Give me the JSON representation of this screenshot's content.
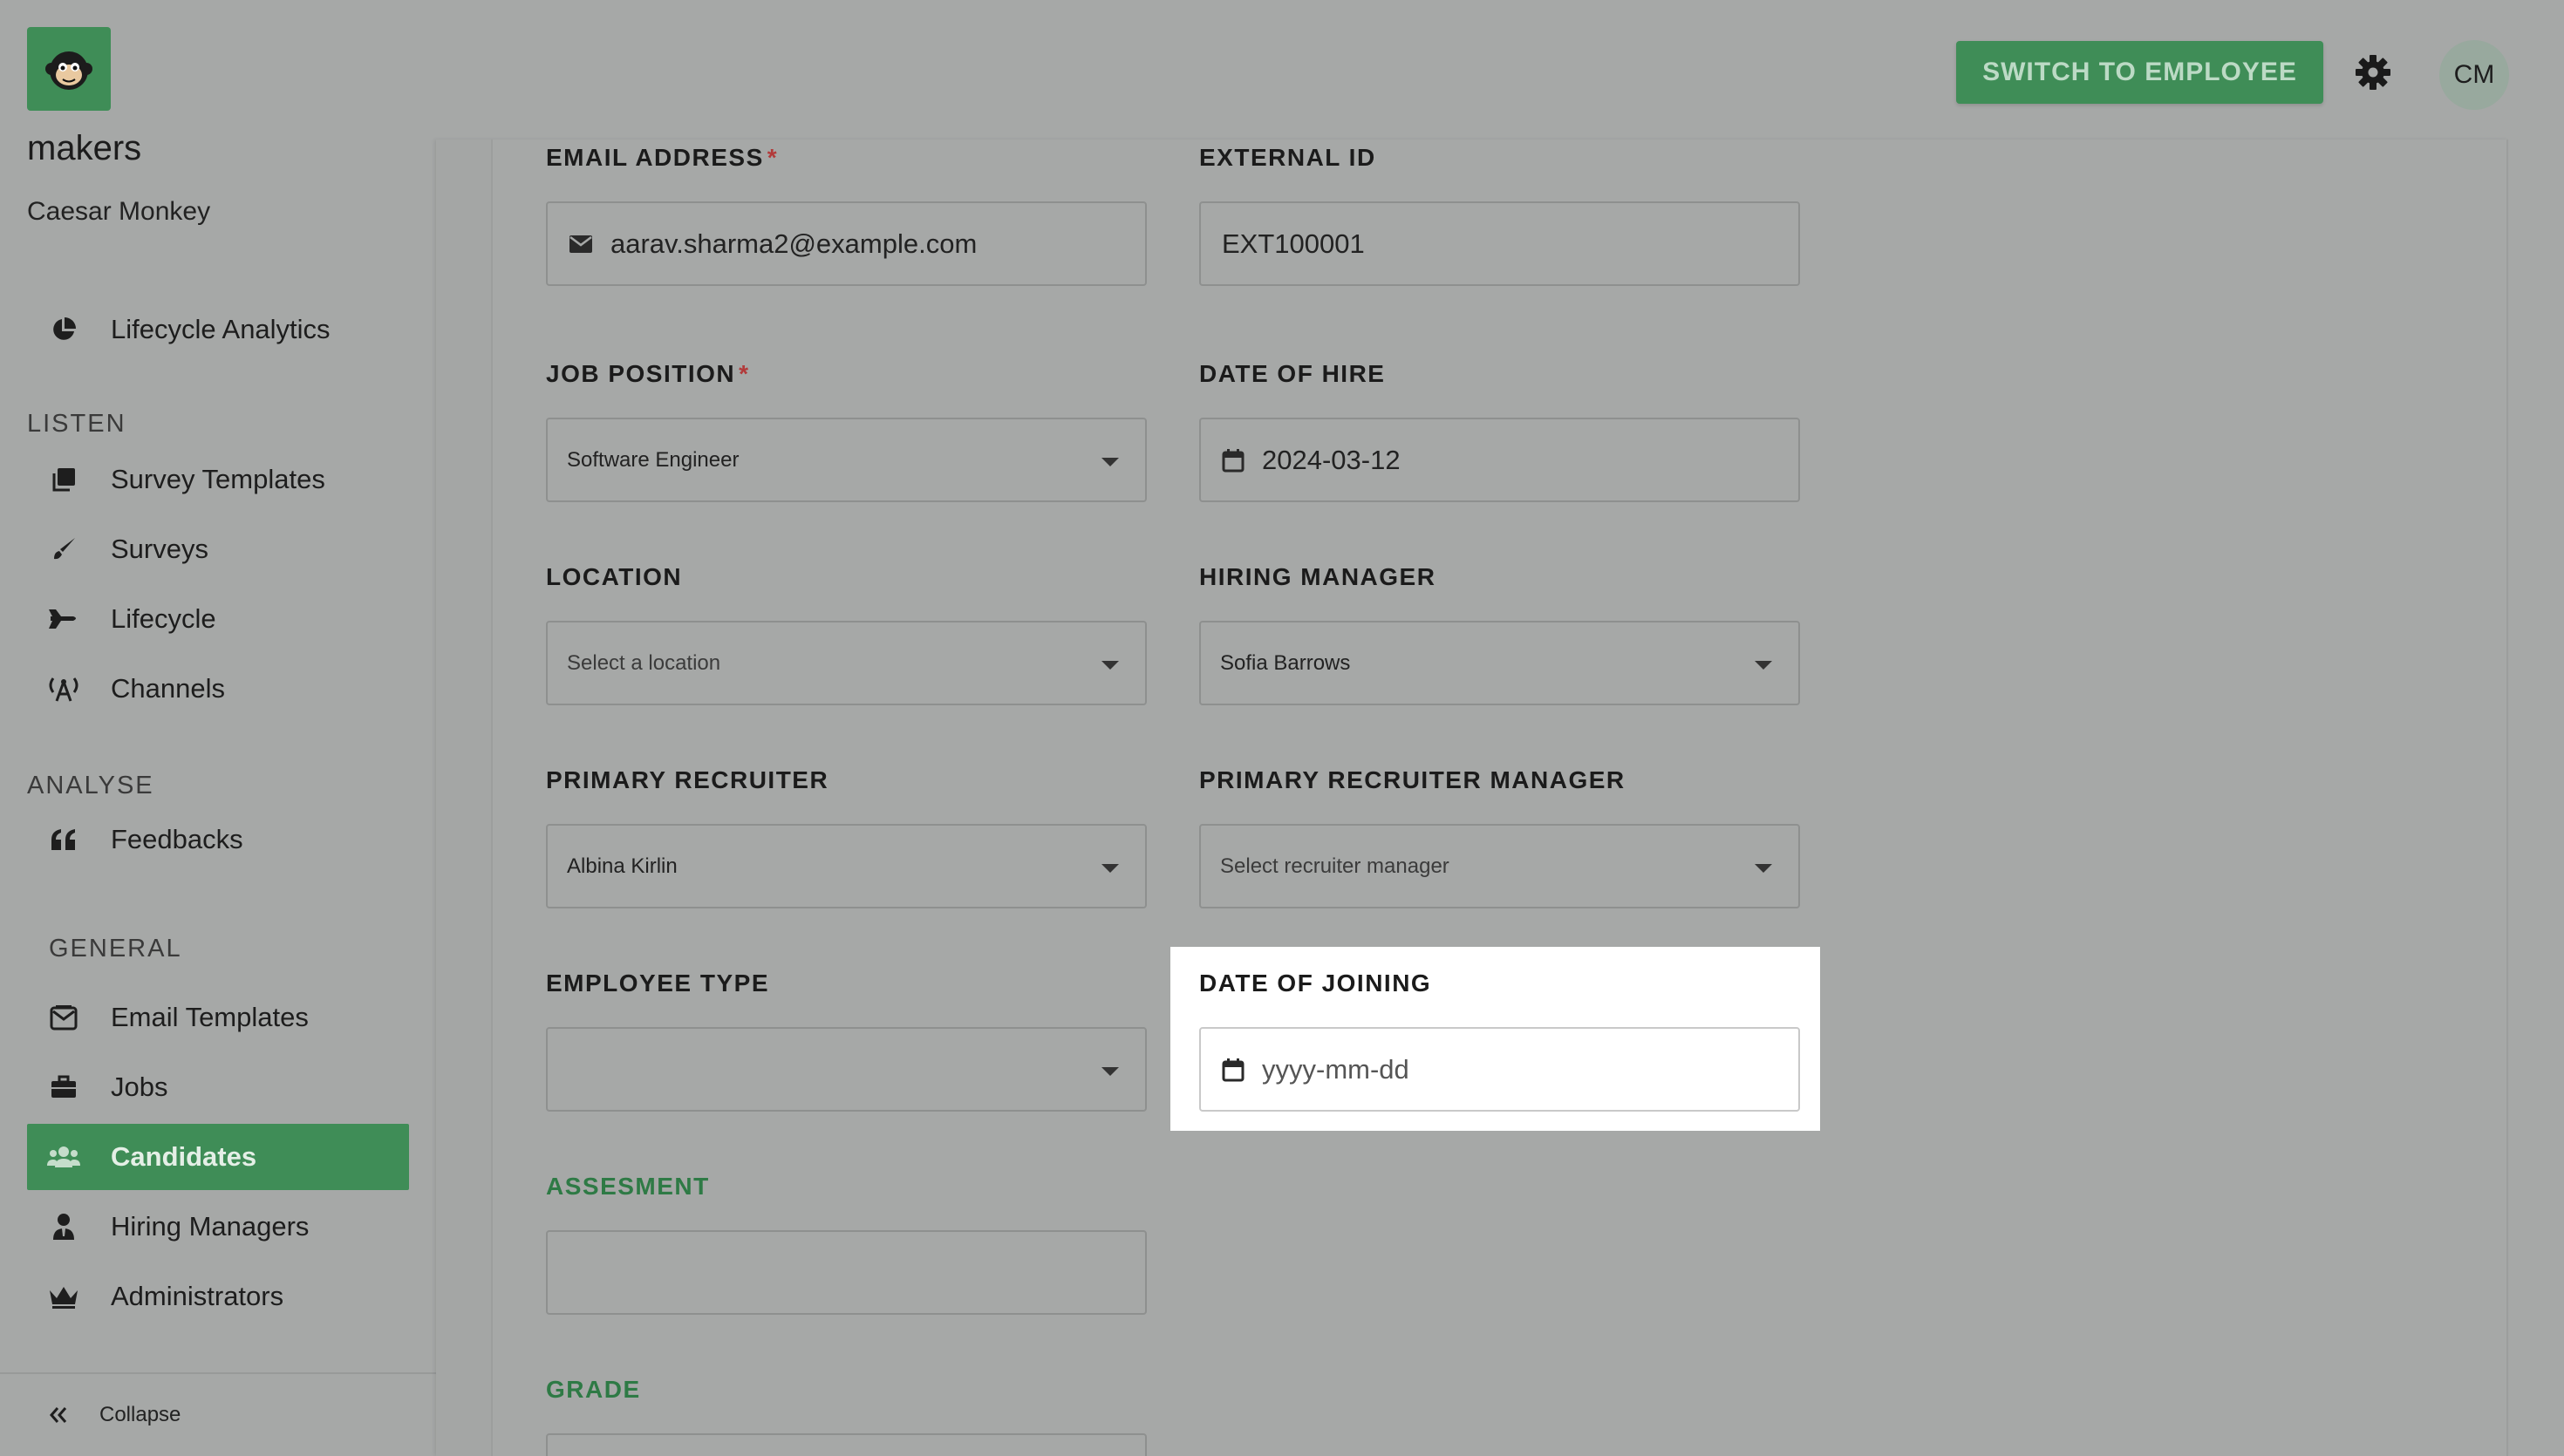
{
  "sidebar": {
    "brand": "makers",
    "user_name": "Caesar Monkey",
    "top_item": {
      "label": "Lifecycle Analytics",
      "icon": "pie-chart-icon"
    },
    "sections": [
      {
        "title": "LISTEN",
        "items": [
          {
            "label": "Survey Templates",
            "icon": "copy-icon"
          },
          {
            "label": "Surveys",
            "icon": "brush-icon"
          },
          {
            "label": "Lifecycle",
            "icon": "fighter-jet-icon"
          },
          {
            "label": "Channels",
            "icon": "broadcast-icon"
          }
        ]
      },
      {
        "title": "ANALYSE",
        "items": [
          {
            "label": "Feedbacks",
            "icon": "quote-icon"
          }
        ]
      },
      {
        "title": "GENERAL",
        "items": [
          {
            "label": "Email Templates",
            "icon": "mail-bulk-icon"
          },
          {
            "label": "Jobs",
            "icon": "briefcase-icon"
          },
          {
            "label": "Candidates",
            "icon": "users-icon",
            "active": true
          },
          {
            "label": "Hiring Managers",
            "icon": "user-tie-icon"
          },
          {
            "label": "Administrators",
            "icon": "crown-icon"
          }
        ]
      }
    ],
    "collapse_label": "Collapse"
  },
  "header": {
    "switch_label": "SWITCH TO EMPLOYEE",
    "avatar_initials": "CM"
  },
  "form": {
    "email": {
      "label": "EMAIL ADDRESS",
      "required": "*",
      "value": "aarav.sharma2@example.com"
    },
    "external_id": {
      "label": "EXTERNAL ID",
      "value": "EXT100001"
    },
    "job_position": {
      "label": "JOB POSITION",
      "required": "*",
      "value": "Software Engineer"
    },
    "date_of_hire": {
      "label": "DATE OF HIRE",
      "value": "2024-03-12"
    },
    "location": {
      "label": "LOCATION",
      "placeholder": "Select a location"
    },
    "hiring_manager": {
      "label": "HIRING MANAGER",
      "value": "Sofia Barrows"
    },
    "primary_recruiter": {
      "label": "PRIMARY RECRUITER",
      "value": "Albina Kirlin"
    },
    "primary_recruiter_manager": {
      "label": "PRIMARY RECRUITER MANAGER",
      "placeholder": "Select recruiter manager"
    },
    "employee_type": {
      "label": "EMPLOYEE TYPE",
      "value": ""
    },
    "date_of_joining": {
      "label": "DATE OF JOINING",
      "placeholder": "yyyy-mm-dd"
    },
    "assesment": {
      "label": "ASSESMENT",
      "value": ""
    },
    "grade": {
      "label": "GRADE"
    }
  }
}
